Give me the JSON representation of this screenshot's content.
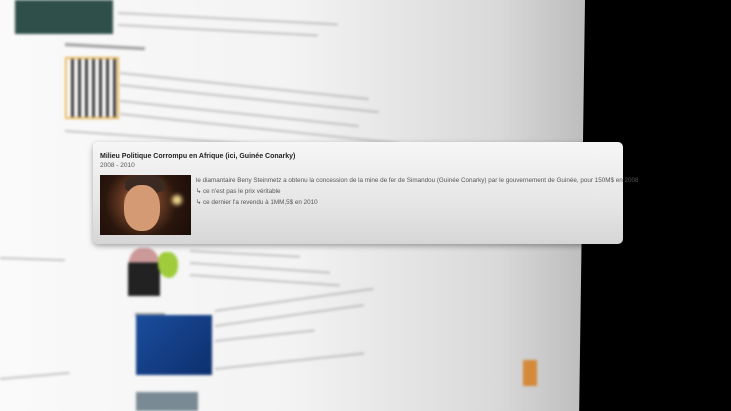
{
  "card": {
    "title": "Milieu Politique Corrompu en Afrique (ici, Guinée Conarky)",
    "date": "2008 - 2010",
    "lines": [
      "le diamantaire Beny Steinmetz a obtenu la concession de la mine de fer de Simandou (Guinée Conarky) par le gouvernement de Guinée, pour 150M$ en 2008",
      "↳ ce n'est pas le prix véritable",
      "↳ ce dernier l'a revendu à 1MM,5$ en 2010"
    ]
  },
  "colors": {
    "background": "#000000",
    "page": "#f3f3f3",
    "card": "#e6e6e6"
  }
}
